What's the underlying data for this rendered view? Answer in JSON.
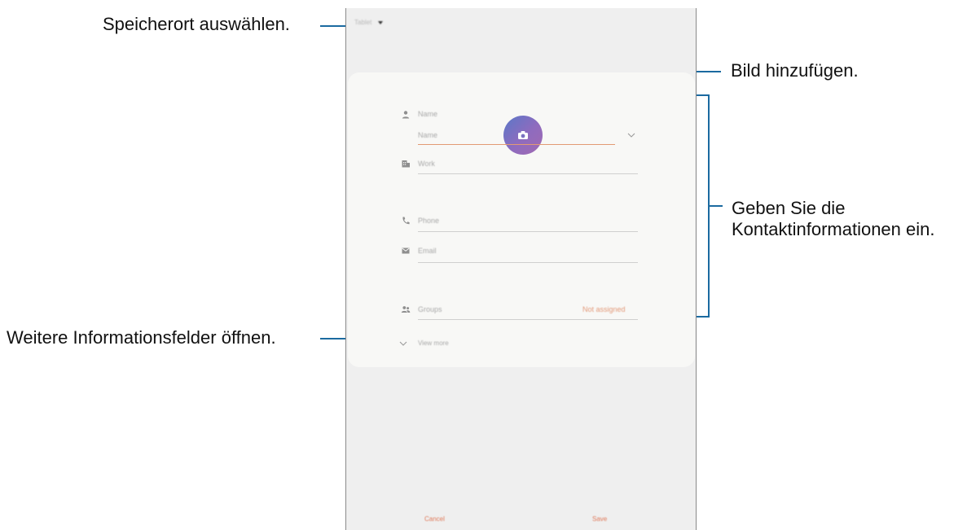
{
  "callouts": {
    "storage": "Speicherort auswählen.",
    "picture": "Bild hinzufügen.",
    "contact_info_line1": "Geben Sie die",
    "contact_info_line2": "Kontaktinformationen ein.",
    "more_fields": "Weitere Informationsfelder öffnen."
  },
  "device": {
    "storage_value": "Tablet",
    "fields": {
      "name_label": "Name",
      "name_input": "Name",
      "work": "Work",
      "phone": "Phone",
      "email": "Email",
      "groups": "Groups",
      "groups_value": "Not assigned",
      "view_more": "View more"
    },
    "buttons": {
      "cancel": "Cancel",
      "save": "Save"
    }
  },
  "colors": {
    "accent": "#e07a5a",
    "callout_line": "#1b6aa0",
    "photo_gradient_start": "#5a78c8",
    "photo_gradient_end": "#a06ab2"
  }
}
